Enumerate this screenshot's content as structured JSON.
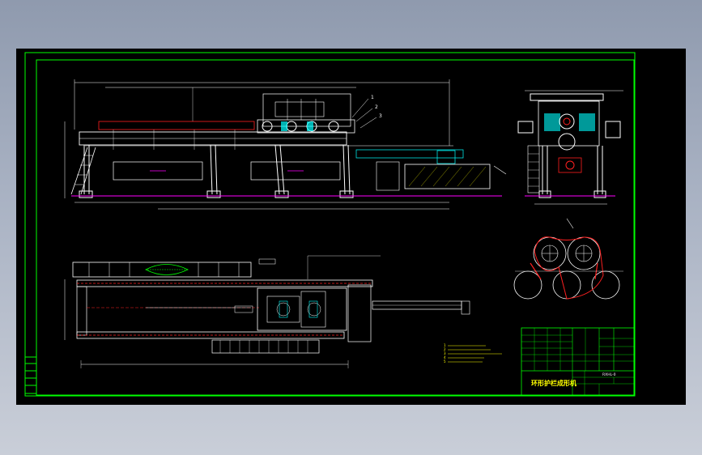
{
  "drawing": {
    "title_block": {
      "title": "环形护栏成形机",
      "drawing_no": "RXHL-0"
    },
    "notes": {
      "items": [
        "1",
        "2",
        "3",
        "4",
        "5"
      ]
    },
    "callouts": [
      "1",
      "2",
      "3"
    ],
    "colors": {
      "background": "#000000",
      "frame": "#00ff00",
      "structure": "#ffffff",
      "accent_magenta": "#ff00ff",
      "accent_red": "#ff2020",
      "accent_cyan": "#00ffff",
      "accent_yellow": "#ffff00"
    }
  }
}
